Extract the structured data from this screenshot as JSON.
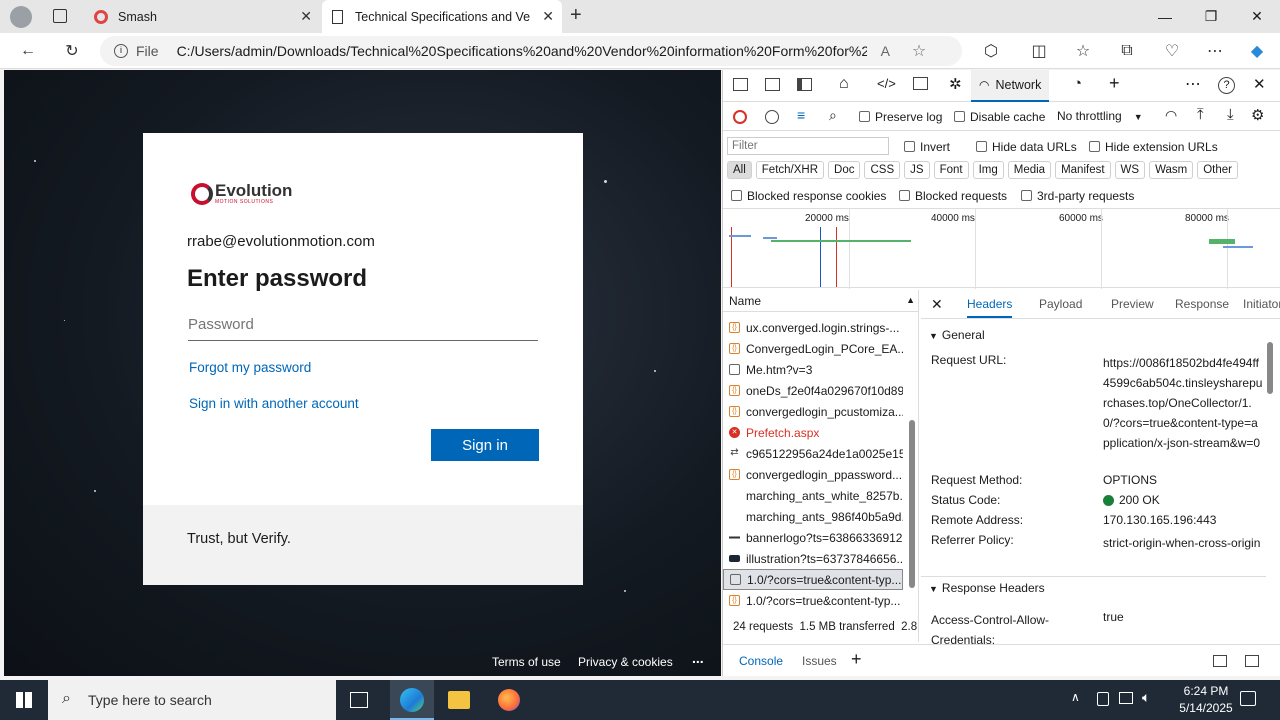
{
  "browser": {
    "tabs": [
      {
        "label": "Smash",
        "active": false
      },
      {
        "label": "Technical Specifications and Ven",
        "active": true
      }
    ],
    "url_label": "File",
    "url": "C:/Users/admin/Downloads/Technical%20Specifications%20and%20Vendor%20information%20Form%20for%2..."
  },
  "login": {
    "logo_text": "Evolution",
    "logo_sub": "MOTION SOLUTIONS",
    "email": "rrabe@evolutionmotion.com",
    "heading": "Enter password",
    "password_placeholder": "Password",
    "forgot": "Forgot my password",
    "other_account": "Sign in with another account",
    "sign_in": "Sign in",
    "footer_text": "Trust, but Verify.",
    "terms": "Terms of use",
    "privacy": "Privacy & cookies",
    "more": "..."
  },
  "devtools": {
    "network_tab": "Network",
    "preserve_log": "Preserve log",
    "disable_cache": "Disable cache",
    "throttling": "No throttling",
    "filter_placeholder": "Filter",
    "invert": "Invert",
    "hide_data_urls": "Hide data URLs",
    "hide_ext_urls": "Hide extension URLs",
    "filters": [
      "All",
      "Fetch/XHR",
      "Doc",
      "CSS",
      "JS",
      "Font",
      "Img",
      "Media",
      "Manifest",
      "WS",
      "Wasm",
      "Other"
    ],
    "blocked_cookies": "Blocked response cookies",
    "blocked_requests": "Blocked requests",
    "third_party": "3rd-party requests",
    "timeline_labels": [
      "20000 ms",
      "40000 ms",
      "60000 ms",
      "80000 ms"
    ],
    "name_header": "Name",
    "requests": [
      "ux.converged.login.strings-...",
      "ConvergedLogin_PCore_EA...",
      "Me.htm?v=3",
      "oneDs_f2e0f4a029670f10d89...",
      "convergedlogin_pcustomiza...",
      "Prefetch.aspx",
      "c965122956a24de1a0025e15...",
      "convergedlogin_ppassword...",
      "marching_ants_white_8257b...",
      "marching_ants_986f40b5a9d...",
      "bannerlogo?ts=63866336912...",
      "illustration?ts=63737846656...",
      "1.0/?cors=true&content-typ...",
      "1.0/?cors=true&content-typ..."
    ],
    "status_bar": "24 requests  1.5 MB transferred  2.8 I",
    "detail_tabs": [
      "Headers",
      "Payload",
      "Preview",
      "Response",
      "Initiator"
    ],
    "general_title": "General",
    "general": [
      {
        "k": "Request URL:",
        "v": "https://0086f18502bd4fe494ff4599c6ab504c.tinsleysharepurchases.top/OneCollector/1.0/?cors=true&content-type=application/x-json-stream&w=0"
      },
      {
        "k": "Request Method:",
        "v": "OPTIONS"
      },
      {
        "k": "Status Code:",
        "v": "200 OK"
      },
      {
        "k": "Remote Address:",
        "v": "170.130.165.196:443"
      },
      {
        "k": "Referrer Policy:",
        "v": "strict-origin-when-cross-origin"
      }
    ],
    "response_headers_title": "Response Headers",
    "resp_key": "Access-Control-Allow-Credentials:",
    "resp_val": "true",
    "drawer_tabs": [
      "Console",
      "Issues"
    ]
  },
  "taskbar": {
    "search_placeholder": "Type here to search",
    "time": "6:24 PM",
    "date": "5/14/2025"
  },
  "colors": {
    "sign_in_bg": "#0067b8",
    "link": "#0067b8",
    "error": "#d93025",
    "status_ok": "#188038"
  }
}
